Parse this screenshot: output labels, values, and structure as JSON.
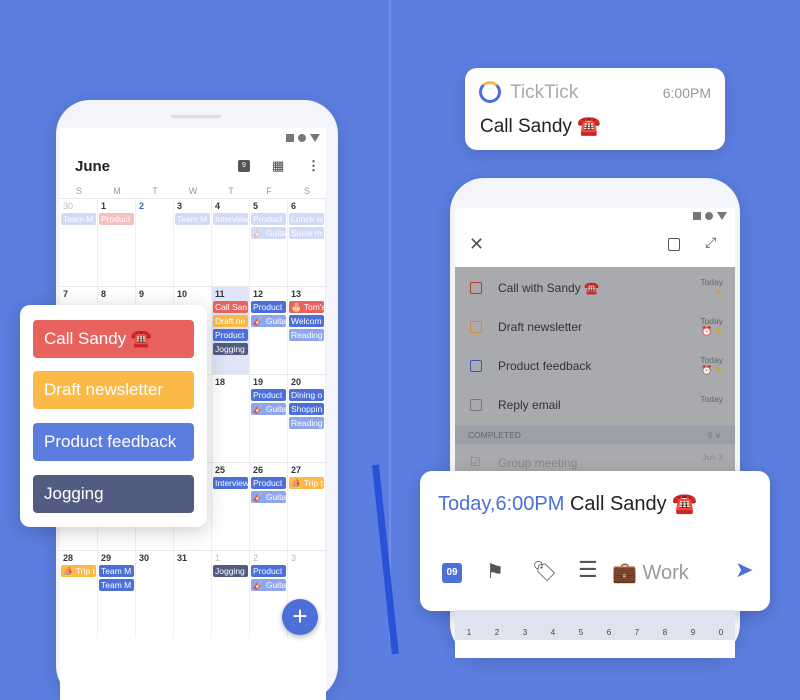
{
  "colors": {
    "background": "#5b7ee0",
    "red": "#e8635e",
    "orange": "#fbb947",
    "blue": "#4c6fd8",
    "navy": "#525c80"
  },
  "calendar": {
    "month": "June",
    "header_icons": [
      "calendar-today-icon",
      "grid-view-icon",
      "more-vert-icon"
    ],
    "today_icon_number": "9",
    "weekdays": [
      "S",
      "M",
      "T",
      "W",
      "T",
      "F",
      "S"
    ],
    "weeks": [
      [
        {
          "d": "30",
          "m": true,
          "ev": [
            [
              "Team M",
              "light",
              1
            ]
          ]
        },
        {
          "d": "1",
          "ev": [
            [
              "Product",
              "red",
              1
            ]
          ]
        },
        {
          "d": "2",
          "hl": true,
          "ev": []
        },
        {
          "d": "3",
          "ev": [
            [
              "Team M",
              "light",
              1
            ]
          ]
        },
        {
          "d": "4",
          "ev": [
            [
              "Interview",
              "light",
              1
            ]
          ]
        },
        {
          "d": "5",
          "ev": [
            [
              "Product",
              "light",
              1
            ],
            [
              "🎸 Guita",
              "light",
              1
            ]
          ]
        },
        {
          "d": "6",
          "ev": [
            [
              "Lunch w",
              "light",
              1
            ],
            [
              "Socia m",
              "light",
              1
            ]
          ]
        }
      ],
      [
        {
          "d": "7",
          "ev": []
        },
        {
          "d": "8",
          "ev": []
        },
        {
          "d": "9",
          "ev": []
        },
        {
          "d": "10",
          "ev": []
        },
        {
          "d": "11",
          "today": true,
          "ev": [
            [
              "Call San",
              "red"
            ],
            [
              "Draft ne",
              "orange"
            ],
            [
              "Product",
              "blue"
            ],
            [
              "Jogging",
              "navy"
            ]
          ]
        },
        {
          "d": "12",
          "ev": [
            [
              "Product",
              "blue"
            ],
            [
              "🎸 Guita",
              "light"
            ]
          ]
        },
        {
          "d": "13",
          "ev": [
            [
              "🎂 Tom's",
              "red"
            ],
            [
              "Welcom",
              "blue"
            ],
            [
              "Reading",
              "light"
            ]
          ]
        }
      ],
      [
        {
          "d": "14",
          "ev": []
        },
        {
          "d": "15",
          "ev": []
        },
        {
          "d": "16",
          "ev": []
        },
        {
          "d": "17",
          "ev": []
        },
        {
          "d": "18",
          "ev": []
        },
        {
          "d": "19",
          "ev": [
            [
              "Product",
              "blue"
            ],
            [
              "🎸 Guita",
              "light"
            ]
          ]
        },
        {
          "d": "20",
          "ev": [
            [
              "Dining o",
              "blue"
            ],
            [
              "Shoppin",
              "blue"
            ],
            [
              "Reading",
              "light"
            ]
          ]
        }
      ],
      [
        {
          "d": "21",
          "ev": []
        },
        {
          "d": "22",
          "ev": []
        },
        {
          "d": "23",
          "ev": []
        },
        {
          "d": "24",
          "ev": []
        },
        {
          "d": "25",
          "ev": [
            [
              "Interview",
              "blue"
            ]
          ]
        },
        {
          "d": "26",
          "ev": [
            [
              "Product",
              "blue"
            ],
            [
              "🎸 Guita",
              "light"
            ]
          ]
        },
        {
          "d": "27",
          "ev": [
            [
              "⛵ Trip t",
              "orange"
            ]
          ]
        }
      ],
      [
        {
          "d": "28",
          "ev": [
            [
              "⛵ Trip t",
              "orange"
            ]
          ]
        },
        {
          "d": "29",
          "ev": [
            [
              "Team M",
              "blue"
            ],
            [
              "Team M",
              "blue"
            ]
          ]
        },
        {
          "d": "30",
          "ev": []
        },
        {
          "d": "31",
          "ev": []
        },
        {
          "d": "1",
          "m": true,
          "ev": [
            [
              "Jogging",
              "navy"
            ]
          ]
        },
        {
          "d": "2",
          "m": true,
          "ev": [
            [
              "Product",
              "blue"
            ],
            [
              "🎸 Guita",
              "light"
            ]
          ]
        },
        {
          "d": "3",
          "m": true,
          "ev": []
        }
      ]
    ],
    "add_button": "+"
  },
  "popup": {
    "items": [
      {
        "label": "Call Sandy ☎️",
        "color": "red"
      },
      {
        "label": "Draft newsletter",
        "color": "orange"
      },
      {
        "label": "Product feedback",
        "color": "blue"
      },
      {
        "label": "Jogging",
        "color": "navy"
      }
    ]
  },
  "notification": {
    "app": "TickTick",
    "time": "6:00PM",
    "title": "Call Sandy ☎️"
  },
  "tasks": {
    "items": [
      {
        "title": "Call with Sandy ☎️",
        "date": "Today",
        "meta": "★",
        "check_color": "#c0392b"
      },
      {
        "title": "Draft newsletter",
        "date": "Today",
        "meta": "⏰ ★",
        "check_color": "#d9822b"
      },
      {
        "title": "Product feedback",
        "date": "Today",
        "meta": "⏰ ★",
        "check_color": "#3d55b8"
      },
      {
        "title": "Reply email",
        "date": "Today",
        "meta": "",
        "check_color": "#777777"
      }
    ],
    "completed_label": "COMPLETED",
    "completed_count": "6 ∨",
    "completed_items": [
      {
        "title": "Group meeting",
        "date": "Jun 3"
      }
    ]
  },
  "quick_add": {
    "date_text": "Today,6:00PM",
    "title": "Call Sandy ☎️",
    "date_icon_number": "09",
    "list": "💼 Work"
  },
  "keyboard": [
    "1",
    "2",
    "3",
    "4",
    "5",
    "6",
    "7",
    "8",
    "9",
    "0"
  ]
}
